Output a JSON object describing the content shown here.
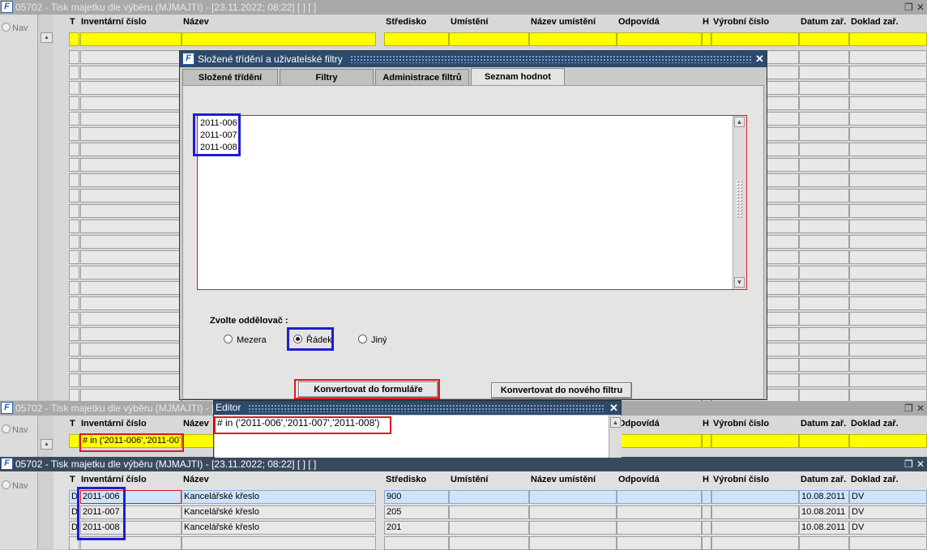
{
  "columns": [
    "T",
    "Inventární číslo",
    "Název",
    "Středisko",
    "Umístění",
    "Název umístění",
    "Odpovídá",
    "H",
    "Výrobní číslo",
    "Datum zař.",
    "Doklad zař."
  ],
  "nav_label": "Nav",
  "window1": {
    "title": "05702 - Tisk majetku dle výběru (MJMAJTI) - [23.11.2022; 08:22]  [ ]  [ ]"
  },
  "window2": {
    "title": "05702 - Tisk majetku dle výběru (MJMAJTI) - [",
    "filter_cell": "# in ('2011-006','2011-007"
  },
  "window3": {
    "title": "05702 - Tisk majetku dle výběru (MJMAJTI) - [23.11.2022; 08:22]  [ ]  [ ]",
    "rows": [
      {
        "t": "D",
        "inv": "2011-006",
        "nazev": "Kancelářské křeslo",
        "stredisko": "900",
        "datum": "10.08.2011",
        "doklad": "DV"
      },
      {
        "t": "D",
        "inv": "2011-007",
        "nazev": "Kancelářské křeslo",
        "stredisko": "205",
        "datum": "10.08.2011",
        "doklad": "DV"
      },
      {
        "t": "D",
        "inv": "2011-008",
        "nazev": "Kancelářské křeslo",
        "stredisko": "201",
        "datum": "10.08.2011",
        "doklad": "DV"
      }
    ]
  },
  "dialog": {
    "title": "Složené třídění a uživatelské filtry",
    "tabs": [
      "Složené třídění",
      "Filtry",
      "Administrace filtrů",
      "Seznam hodnot"
    ],
    "active_tab": "Seznam hodnot",
    "list_values": [
      "2011-006",
      "2011-007",
      "2011-008"
    ],
    "separator_label": "Zvolte oddělovač :",
    "separators": [
      {
        "label": "Mezera",
        "selected": false
      },
      {
        "label": "Řádek",
        "selected": true
      },
      {
        "label": "Jiný",
        "selected": false
      }
    ],
    "btn_convert_form": "Konvertovat do formuláře",
    "btn_convert_filter": "Konvertovat do nového filtru"
  },
  "editor": {
    "title": "Editor",
    "text": "# in ('2011-006','2011-007','2011-008')"
  },
  "colors": {
    "title_active": "#3a4a5e",
    "title_inactive": "#a9a9a9",
    "highlight_yellow": "#ffff00",
    "annotation_red": "#e01818",
    "annotation_blue": "#1d1dd8"
  }
}
